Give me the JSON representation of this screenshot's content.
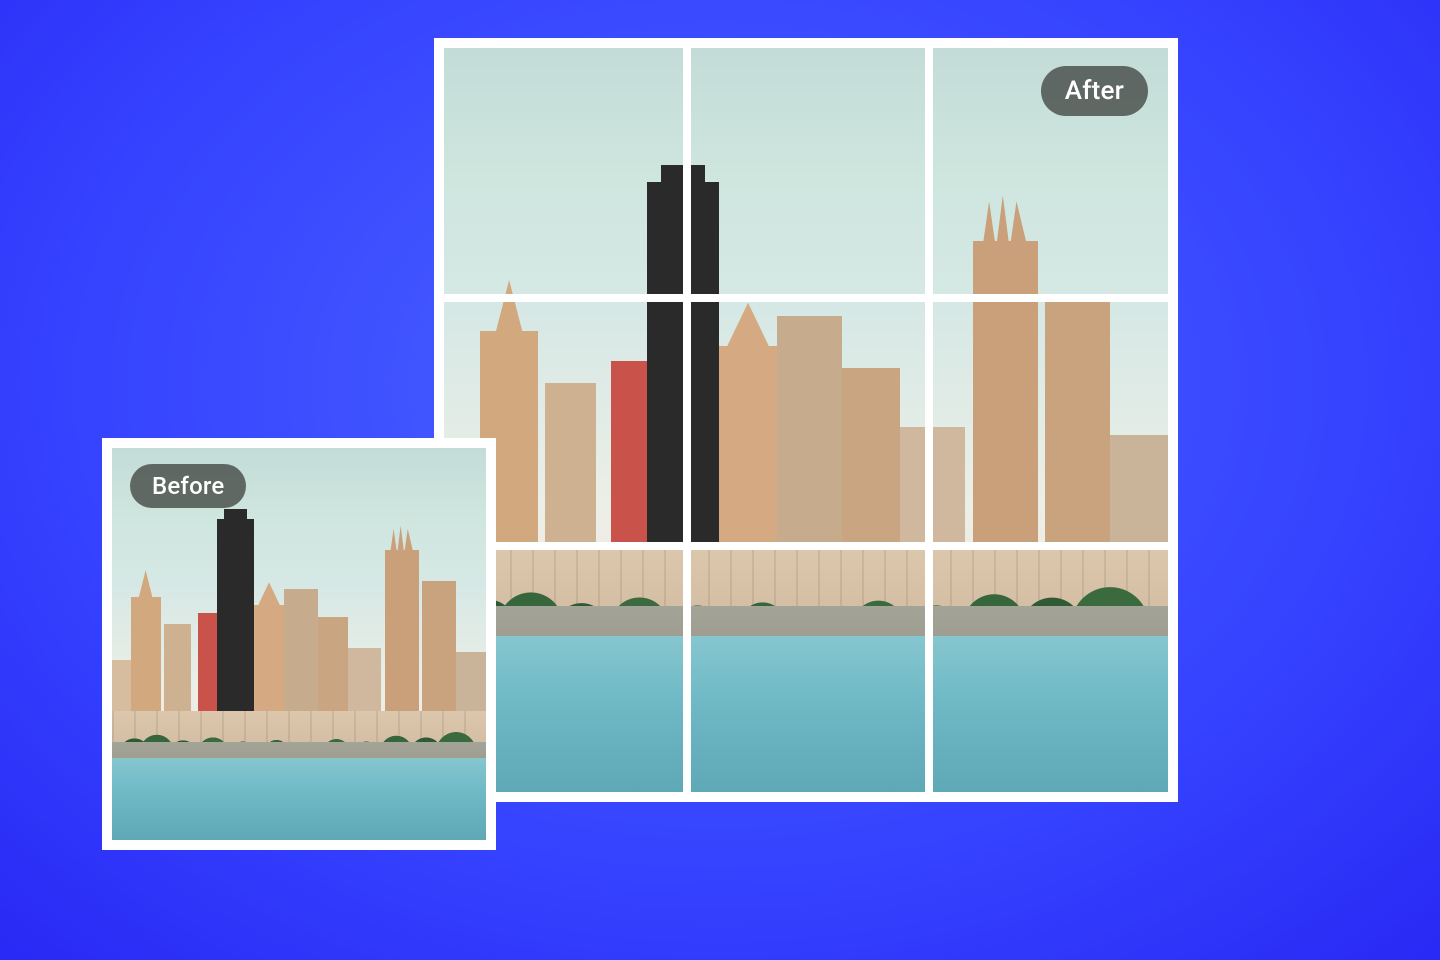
{
  "labels": {
    "before": "Before",
    "after": "After"
  },
  "grid": {
    "rows": 3,
    "cols": 3
  },
  "colors": {
    "background_center": "#4a63ff",
    "background_edge": "#2420f0",
    "frame": "#ffffff",
    "badge_bg": "rgba(80,86,82,.88)",
    "badge_text": "#ffffff"
  }
}
